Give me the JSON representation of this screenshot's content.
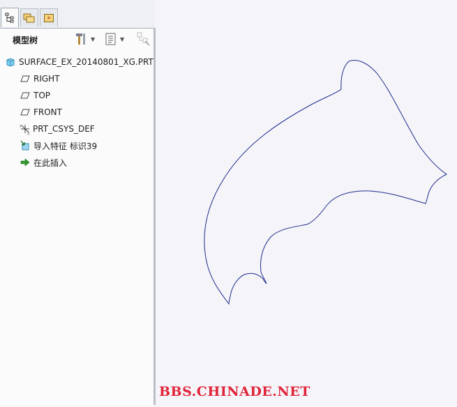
{
  "tabs": [
    {
      "icon": "model-tree-icon"
    },
    {
      "icon": "folder-browser-icon"
    },
    {
      "icon": "favorites-icon"
    }
  ],
  "panel": {
    "title": "模型树",
    "tools": [
      "settings-tools-icon",
      "tree-columns-icon",
      "show-hide-icon"
    ]
  },
  "tree": {
    "items": [
      {
        "label": "SURFACE_EX_20140801_XG.PRT",
        "icon": "part-icon"
      },
      {
        "label": "RIGHT",
        "icon": "datum-plane-icon"
      },
      {
        "label": "TOP",
        "icon": "datum-plane-icon"
      },
      {
        "label": "FRONT",
        "icon": "datum-plane-icon"
      },
      {
        "label": "PRT_CSYS_DEF",
        "icon": "coordinate-system-icon"
      },
      {
        "label": "导入特征 标识39",
        "icon": "import-feature-icon"
      },
      {
        "label": "在此插入",
        "icon": "insert-here-arrow-icon"
      }
    ]
  },
  "watermark": "BBS.CHINADE.NET",
  "colors": {
    "curve": "#1d2a8c",
    "watermark": "#e0243a",
    "panel_bg": "#fbfbfc"
  }
}
